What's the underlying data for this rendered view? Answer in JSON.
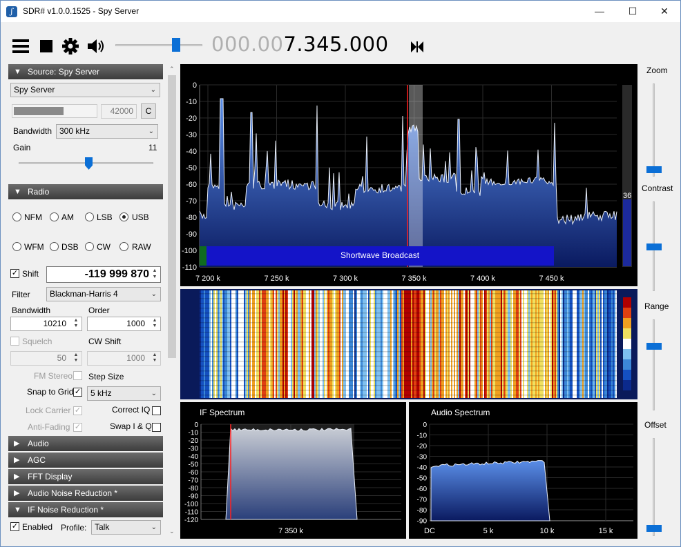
{
  "window": {
    "title": "SDR# v1.0.0.1525 - Spy Server",
    "minimize": "—",
    "maximize": "☐",
    "close": "✕"
  },
  "toolbar": {
    "freq_dim": "000.00",
    "freq_main": "7.345.000"
  },
  "source": {
    "header": "Source: Spy Server",
    "device": "Spy Server",
    "port_value": "42000",
    "connect_label": "C",
    "bandwidth_label": "Bandwidth",
    "bandwidth_value": "300 kHz",
    "gain_label": "Gain",
    "gain_value": "11"
  },
  "radio": {
    "header": "Radio",
    "modes": [
      "NFM",
      "AM",
      "LSB",
      "USB",
      "WFM",
      "DSB",
      "CW",
      "RAW"
    ],
    "selected_mode": "USB",
    "shift_label": "Shift",
    "shift_value": "-119 999 870",
    "filter_label": "Filter",
    "filter_value": "Blackman-Harris 4",
    "bandwidth_label": "Bandwidth",
    "bandwidth_value": "10210",
    "order_label": "Order",
    "order_value": "1000",
    "squelch_label": "Squelch",
    "squelch_value": "50",
    "cwshift_label": "CW Shift",
    "cwshift_value": "1000",
    "fmstereo_label": "FM Stereo",
    "stepsize_label": "Step Size",
    "snap_label": "Snap to Grid",
    "step_value": "5 kHz",
    "lockcarrier_label": "Lock Carrier",
    "correctiq_label": "Correct IQ",
    "antifading_label": "Anti-Fading",
    "swapiq_label": "Swap I & Q"
  },
  "collapsed_sections": [
    "Audio",
    "AGC",
    "FFT Display",
    "Audio Noise Reduction *"
  ],
  "ifnr": {
    "header": "IF Noise Reduction *",
    "enabled_label": "Enabled",
    "profile_label": "Profile:",
    "profile_value": "Talk"
  },
  "sliders": {
    "zoom": "Zoom",
    "contrast": "Contrast",
    "range": "Range",
    "offset": "Offset"
  },
  "spectrum": {
    "band_label": "Shortwave Broadcast",
    "level_value": "36",
    "y_ticks": [
      "0",
      "-10",
      "-20",
      "-30",
      "-40",
      "-50",
      "-60",
      "-70",
      "-80",
      "-90",
      "-100",
      "-110"
    ],
    "x_ticks": [
      "7 200 k",
      "7 250 k",
      "7 300 k",
      "7 350 k",
      "7 400 k",
      "7 450 k"
    ]
  },
  "if_spectrum": {
    "title": "IF Spectrum",
    "y_ticks": [
      "0",
      "-10",
      "-20",
      "-30",
      "-40",
      "-50",
      "-60",
      "-70",
      "-80",
      "-90",
      "-100",
      "-110",
      "-120"
    ],
    "x_ticks": [
      "7 350 k"
    ]
  },
  "audio_spectrum": {
    "title": "Audio Spectrum",
    "y_ticks": [
      "0",
      "-10",
      "-20",
      "-30",
      "-40",
      "-50",
      "-60",
      "-70",
      "-80",
      "-90"
    ],
    "x_ticks": [
      "DC",
      "5 k",
      "10 k",
      "15 k"
    ]
  },
  "colors": {
    "accent": "#0b6fd6",
    "spectrum_fill": "#2a63c8",
    "band": "#1414c8",
    "tuning_line": "#ff2020"
  }
}
